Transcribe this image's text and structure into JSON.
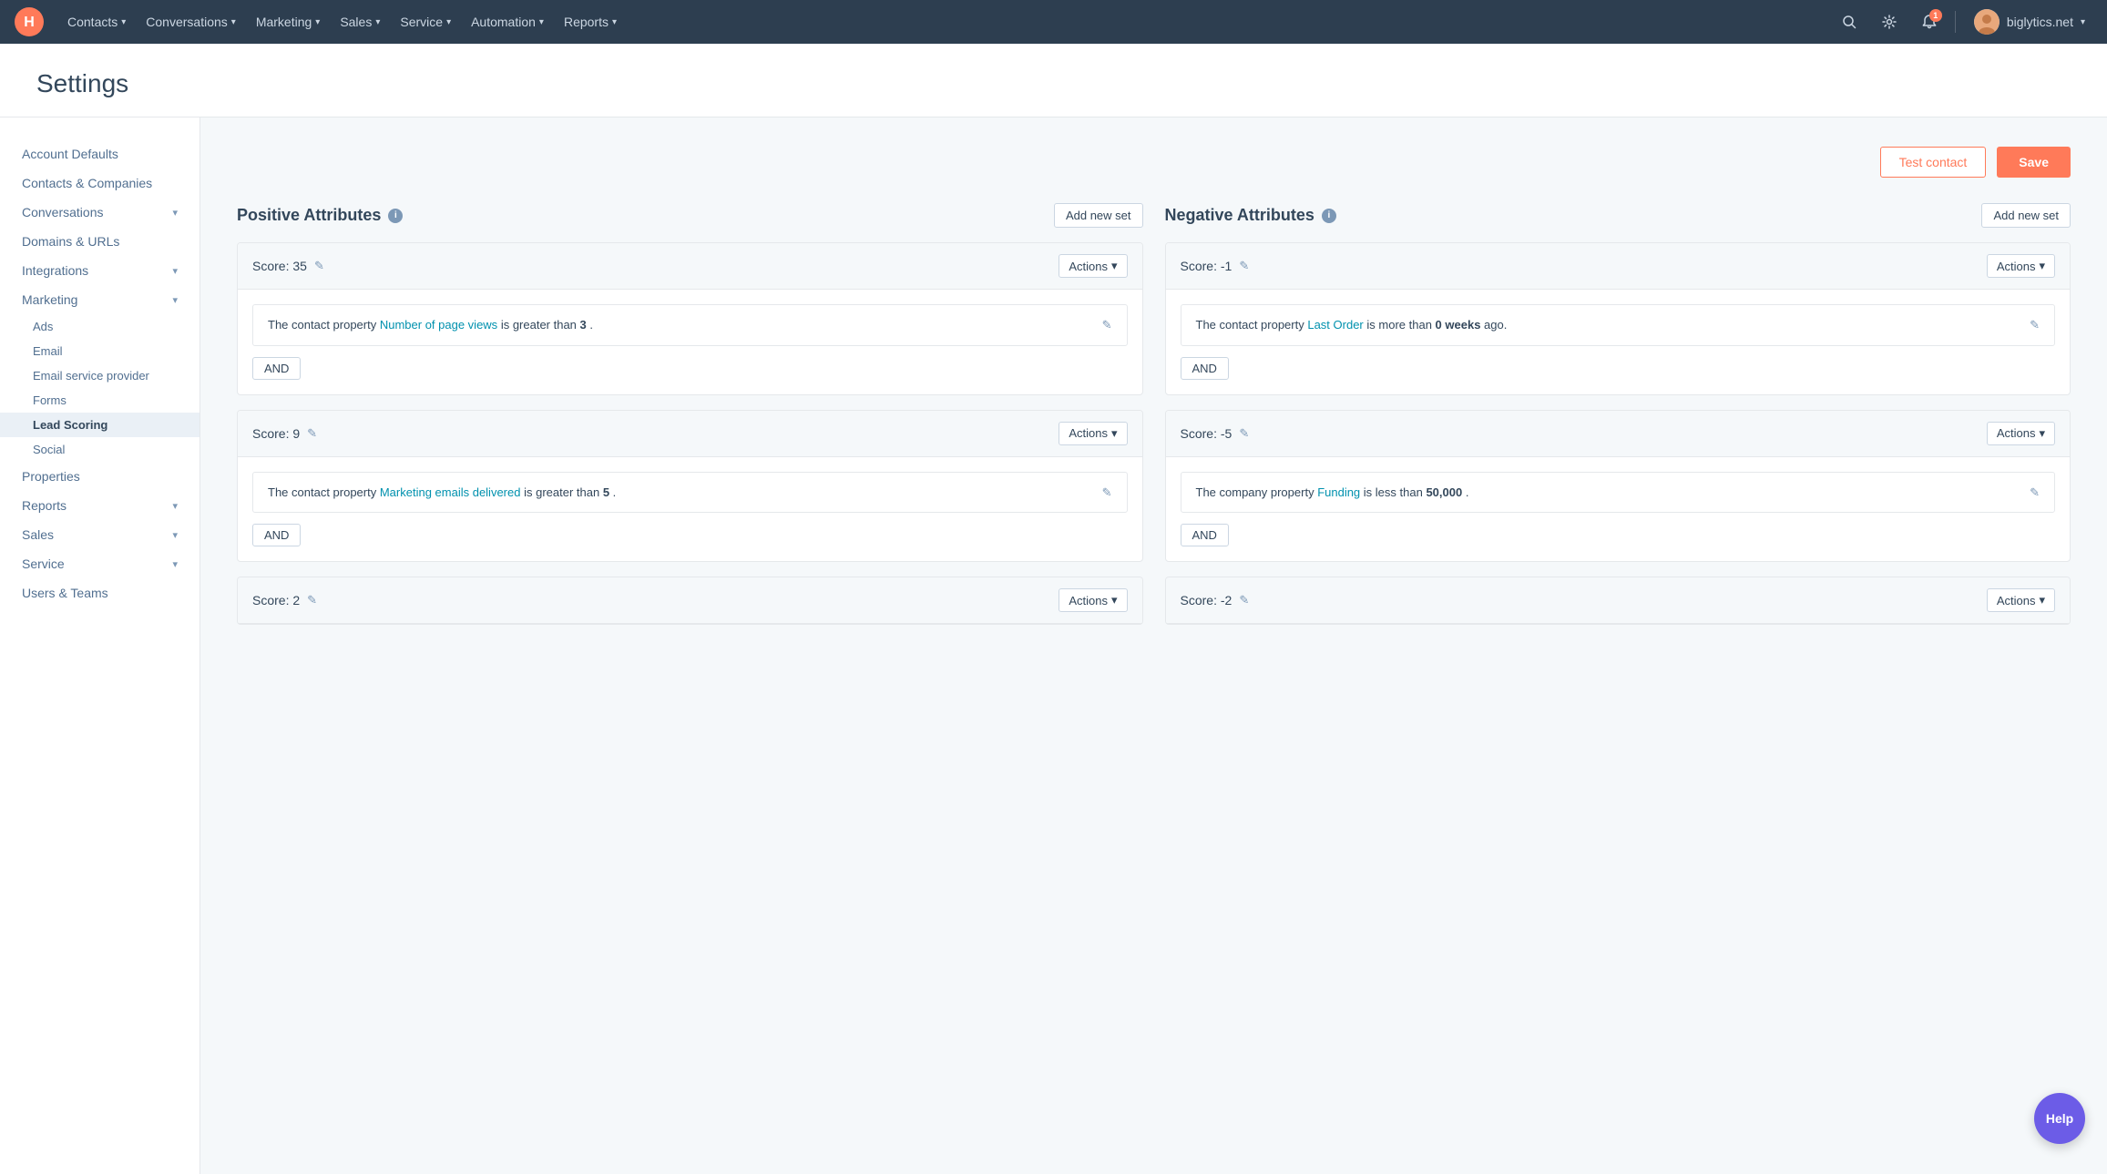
{
  "nav": {
    "logo_text": "H",
    "items": [
      {
        "label": "Contacts",
        "id": "contacts"
      },
      {
        "label": "Conversations",
        "id": "conversations"
      },
      {
        "label": "Marketing",
        "id": "marketing"
      },
      {
        "label": "Sales",
        "id": "sales"
      },
      {
        "label": "Service",
        "id": "service"
      },
      {
        "label": "Automation",
        "id": "automation"
      },
      {
        "label": "Reports",
        "id": "reports"
      }
    ],
    "notification_count": "1",
    "user_domain": "biglytics.net"
  },
  "page": {
    "title": "Settings"
  },
  "sidebar": {
    "items": [
      {
        "label": "Account Defaults",
        "id": "account-defaults",
        "active": false
      },
      {
        "label": "Contacts & Companies",
        "id": "contacts-companies",
        "active": false
      },
      {
        "label": "Conversations",
        "id": "conversations",
        "active": false,
        "expandable": true
      },
      {
        "label": "Domains & URLs",
        "id": "domains",
        "active": false
      },
      {
        "label": "Integrations",
        "id": "integrations",
        "active": false,
        "expandable": true
      },
      {
        "label": "Marketing",
        "id": "marketing",
        "active": false,
        "expandable": true
      },
      {
        "label": "Ads",
        "id": "ads",
        "sub": true
      },
      {
        "label": "Email",
        "id": "email",
        "sub": true
      },
      {
        "label": "Email service provider",
        "id": "email-service-provider",
        "sub": true
      },
      {
        "label": "Forms",
        "id": "forms",
        "sub": true
      },
      {
        "label": "Lead Scoring",
        "id": "lead-scoring",
        "sub": true,
        "active": true
      },
      {
        "label": "Social",
        "id": "social",
        "sub": true
      },
      {
        "label": "Properties",
        "id": "properties",
        "active": false
      },
      {
        "label": "Reports",
        "id": "reports",
        "active": false,
        "expandable": true
      },
      {
        "label": "Sales",
        "id": "sales",
        "active": false,
        "expandable": true
      },
      {
        "label": "Service",
        "id": "service",
        "active": false,
        "expandable": true
      },
      {
        "label": "Users & Teams",
        "id": "users-teams",
        "active": false
      }
    ]
  },
  "lead_scoring": {
    "title": "Lead Scoring",
    "test_contact_label": "Test contact",
    "save_label": "Save",
    "positive": {
      "heading": "Positive Attributes",
      "add_new_set_label": "Add new set",
      "cards": [
        {
          "id": "pos-1",
          "score_label": "Score: 35",
          "actions_label": "Actions",
          "condition": "The contact property Number of page views is greater than 3.",
          "prop_name": "Number of page views",
          "prop_start": "The contact property ",
          "prop_middle": " is greater than ",
          "prop_value": "3",
          "prop_end": ".",
          "and_label": "AND"
        },
        {
          "id": "pos-2",
          "score_label": "Score: 9",
          "actions_label": "Actions",
          "condition": "The contact property Marketing emails delivered is greater than 5.",
          "prop_name": "Marketing emails delivered",
          "prop_start": "The contact property ",
          "prop_middle": " is greater th an ",
          "prop_value": "5",
          "prop_end": ".",
          "and_label": "AND"
        },
        {
          "id": "pos-3",
          "score_label": "Score: 2",
          "actions_label": "Actions"
        }
      ]
    },
    "negative": {
      "heading": "Negative Attributes",
      "add_new_set_label": "Add new set",
      "cards": [
        {
          "id": "neg-1",
          "score_label": "Score: -1",
          "actions_label": "Actions",
          "condition": "The contact property Last Order is more than 0 weeks ago.",
          "prop_name": "Last Order",
          "prop_start": "The contact property ",
          "prop_middle": " is more than ",
          "prop_value": "0 weeks",
          "prop_end": " ago.",
          "and_label": "AND"
        },
        {
          "id": "neg-2",
          "score_label": "Score: -5",
          "actions_label": "Actions",
          "condition": "The company property Funding is less than 50,000.",
          "prop_name": "Funding",
          "prop_start": "The company property ",
          "prop_middle": " is less than ",
          "prop_value": "50,000",
          "prop_end": ".",
          "and_label": "AND"
        },
        {
          "id": "neg-3",
          "score_label": "Score: -2",
          "actions_label": "Actions"
        }
      ]
    }
  },
  "help": {
    "label": "Help"
  }
}
